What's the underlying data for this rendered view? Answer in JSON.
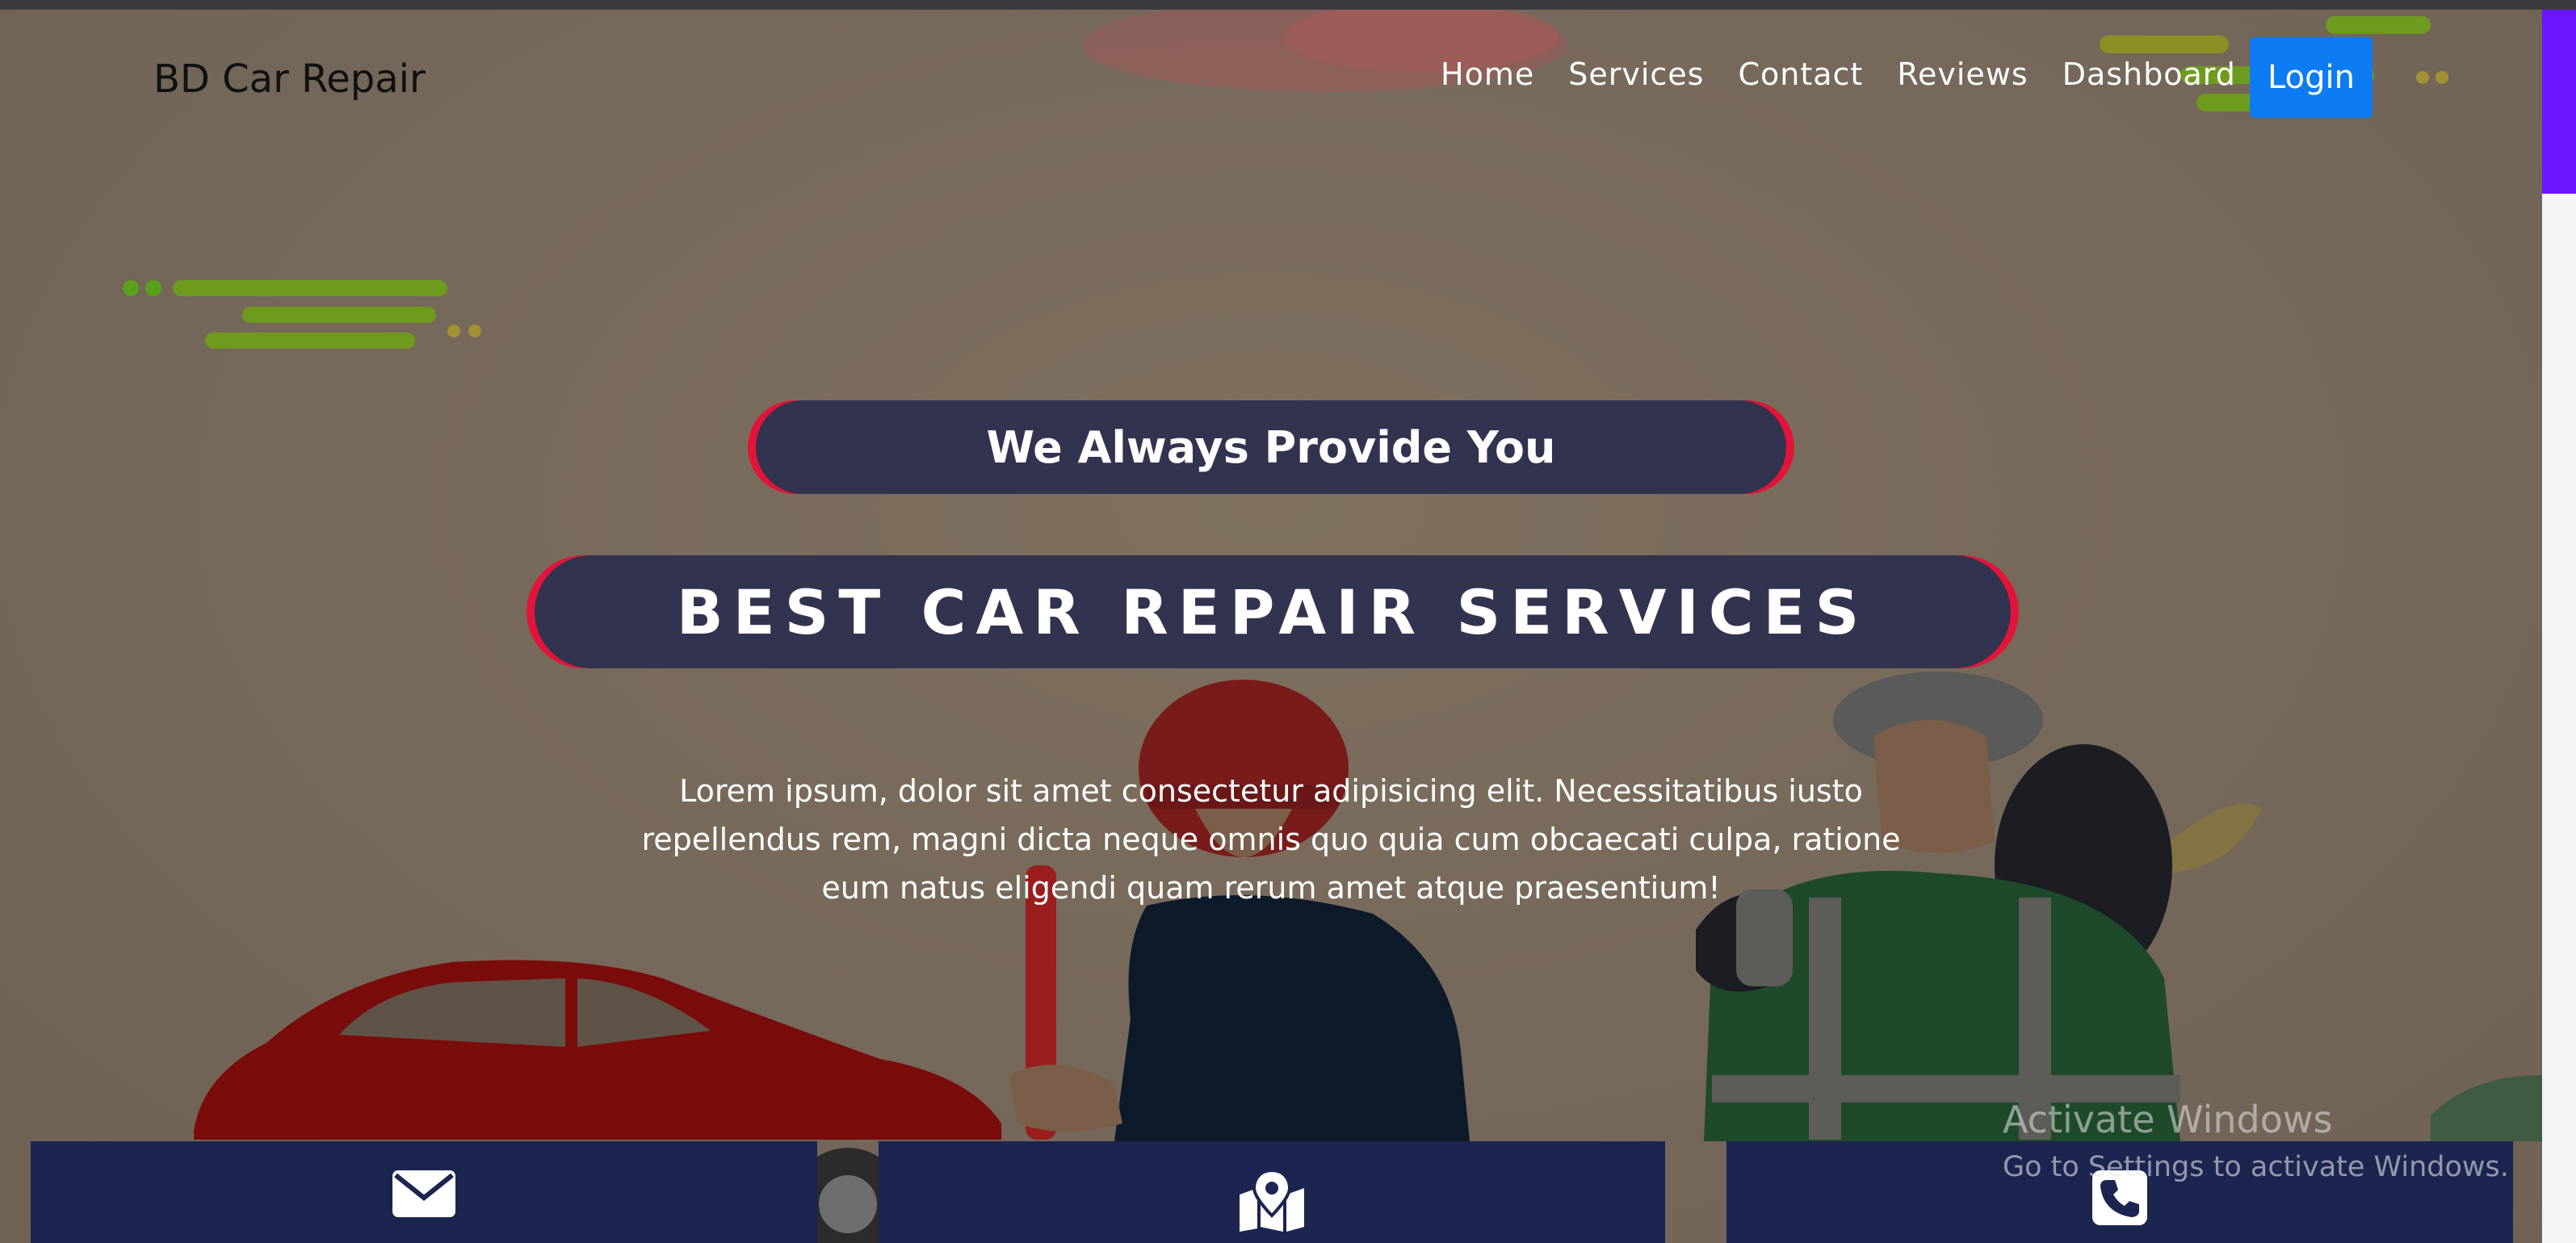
{
  "brand": "BD Car Repair",
  "nav": [
    {
      "label": "Home"
    },
    {
      "label": "Services"
    },
    {
      "label": "Contact"
    },
    {
      "label": "Reviews"
    },
    {
      "label": "Dashboard"
    }
  ],
  "login_label": "Login",
  "hero": {
    "tagline": "We Always Provide You",
    "headline": "BEST CAR REPAIR SERVICES",
    "description": "Lorem ipsum, dolor sit amet consectetur adipisicing elit. Necessitatibus iusto repellendus rem, magni dicta neque omnis quo quia cum obcaecati culpa, ratione eum natus eligendi quam rerum amet atque praesentium!"
  },
  "cards": [
    {
      "icon": "envelope-icon"
    },
    {
      "icon": "map-marker-icon"
    },
    {
      "icon": "phone-icon"
    }
  ],
  "watermark": {
    "title": "Activate Windows",
    "subtitle": "Go to Settings to activate Windows."
  },
  "colors": {
    "accent": "#0d7cf2",
    "pill_bg": "#32334f",
    "pill_edge": "#e3143a",
    "card_bg": "#1c2450",
    "scroll_thumb": "#6c16ff"
  }
}
